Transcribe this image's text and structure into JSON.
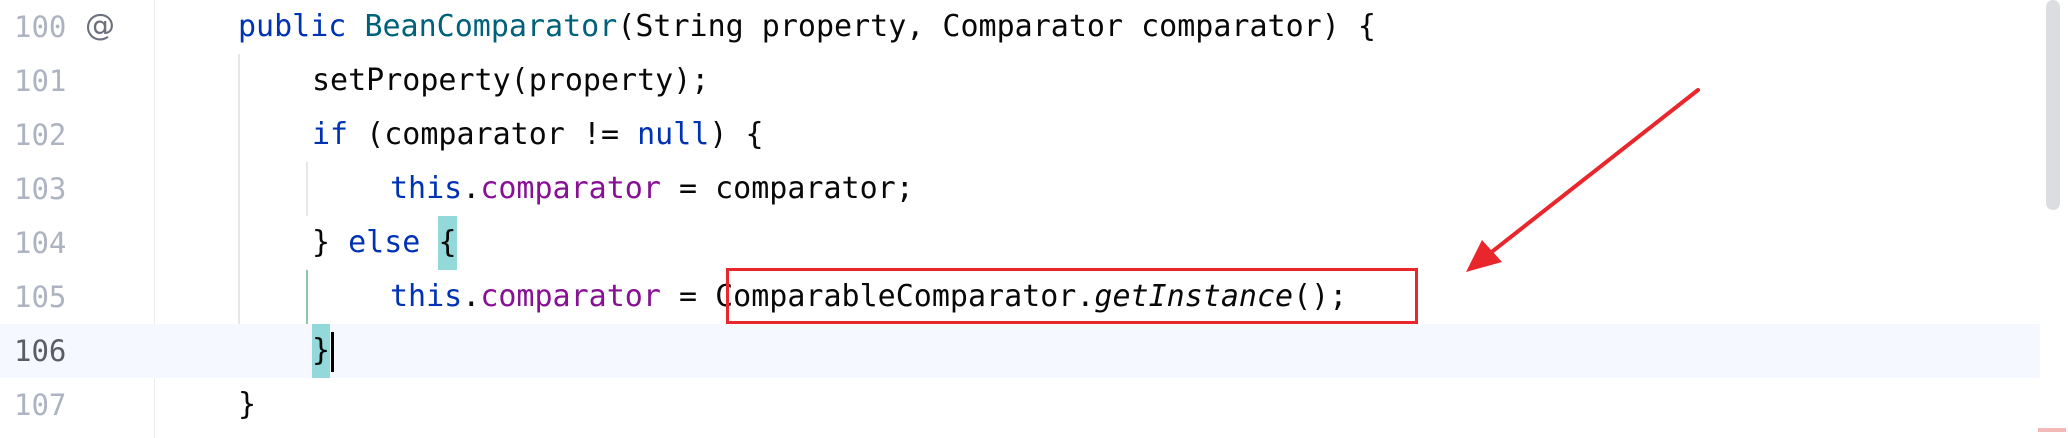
{
  "editor": {
    "lines": [
      {
        "number": "100",
        "gutter_icon": "@",
        "segments": [
          {
            "text": "public",
            "cls": "kw"
          },
          {
            "text": " ",
            "cls": "plain"
          },
          {
            "text": "BeanComparator",
            "cls": "fn"
          },
          {
            "text": "(String property, Comparator comparator) {",
            "cls": "plain"
          }
        ]
      },
      {
        "number": "101",
        "segments": [
          {
            "text": "setProperty(property);",
            "cls": "plain"
          }
        ]
      },
      {
        "number": "102",
        "segments": [
          {
            "text": "if",
            "cls": "kw"
          },
          {
            "text": " (comparator != ",
            "cls": "plain"
          },
          {
            "text": "null",
            "cls": "kw"
          },
          {
            "text": ") {",
            "cls": "plain"
          }
        ]
      },
      {
        "number": "103",
        "segments": [
          {
            "text": "this",
            "cls": "kw"
          },
          {
            "text": ".",
            "cls": "plain"
          },
          {
            "text": "comparator",
            "cls": "field"
          },
          {
            "text": " = comparator;",
            "cls": "plain"
          }
        ]
      },
      {
        "number": "104",
        "segments": [
          {
            "text": "} ",
            "cls": "plain"
          },
          {
            "text": "else",
            "cls": "kw"
          },
          {
            "text": " ",
            "cls": "plain"
          },
          {
            "text": "{",
            "cls": "plain brace-match"
          }
        ]
      },
      {
        "number": "105",
        "segments": [
          {
            "text": "this",
            "cls": "kw"
          },
          {
            "text": ".",
            "cls": "plain"
          },
          {
            "text": "comparator",
            "cls": "field"
          },
          {
            "text": " = ",
            "cls": "plain"
          },
          {
            "text": "ComparableComparator.",
            "cls": "plain"
          },
          {
            "text": "getInstance",
            "cls": "plain italic"
          },
          {
            "text": "();",
            "cls": "plain"
          }
        ]
      },
      {
        "number": "106",
        "current": true,
        "segments": [
          {
            "text": "}",
            "cls": "plain brace-match"
          }
        ],
        "caret": true
      },
      {
        "number": "107",
        "segments": [
          {
            "text": "}",
            "cls": "plain"
          }
        ]
      }
    ]
  },
  "annotation": {
    "box_color": "#e8262b",
    "arrow_color": "#e8262b"
  },
  "colors": {
    "keyword": "#0033b3",
    "method_declaration": "#00627a",
    "field": "#871094",
    "text": "#080808",
    "line_number": "#aeb3c2",
    "brace_match_bg": "#93d9d9",
    "current_line_bg": "#f5f8fe"
  }
}
